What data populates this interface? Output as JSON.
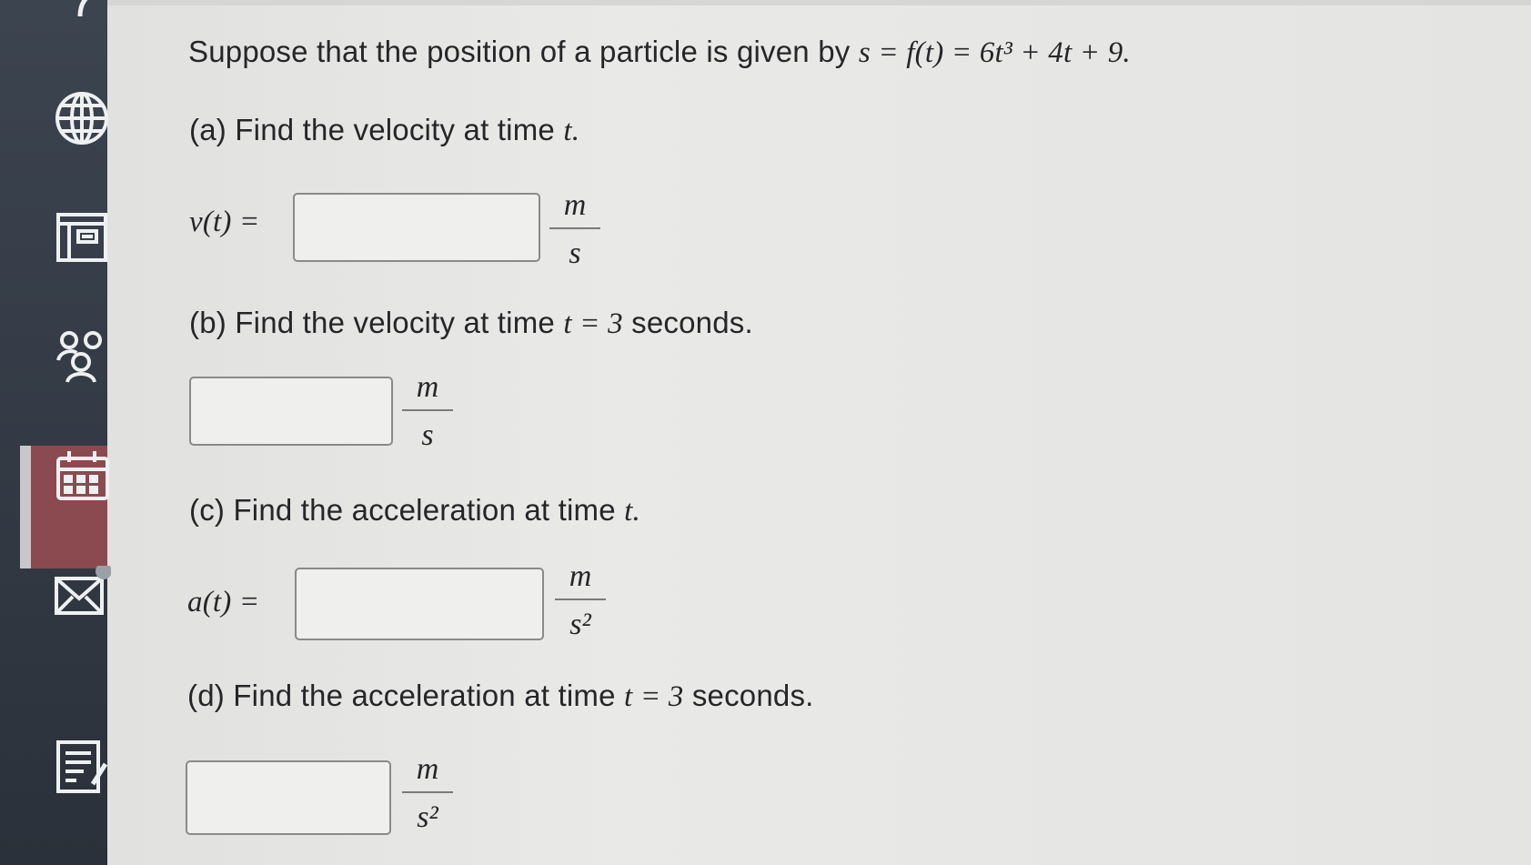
{
  "sidebar": {
    "icons": [
      "person-arc-icon",
      "globe-icon",
      "book-icon",
      "people-icon",
      "calendar-icon",
      "mail-icon",
      "notes-icon"
    ]
  },
  "problem": {
    "intro": "Suppose that the position of a particle is given by",
    "equation": "s = f(t) = 6t³ + 4t + 9.",
    "parts": [
      {
        "label": "(a) Find the velocity at time",
        "var": "t.",
        "lhs": "v(t) =",
        "answer_value": "",
        "unit_num": "m",
        "unit_den": "s"
      },
      {
        "label": "(b) Find the velocity at time",
        "var": "t = 3",
        "suffix": "seconds.",
        "answer_value": "",
        "unit_num": "m",
        "unit_den": "s"
      },
      {
        "label": "(c) Find the acceleration at time",
        "var": "t.",
        "lhs": "a(t) =",
        "answer_value": "",
        "unit_num": "m",
        "unit_den": "s²"
      },
      {
        "label": "(d) Find the acceleration at time",
        "var": "t = 3",
        "suffix": "seconds.",
        "answer_value": "",
        "unit_num": "m",
        "unit_den": "s²"
      }
    ]
  },
  "colors": {
    "sidebar_bg": "#2f3540",
    "sidebar_active": "#8b4a4f",
    "text": "#26262a",
    "box_border": "#8a8a8a"
  }
}
